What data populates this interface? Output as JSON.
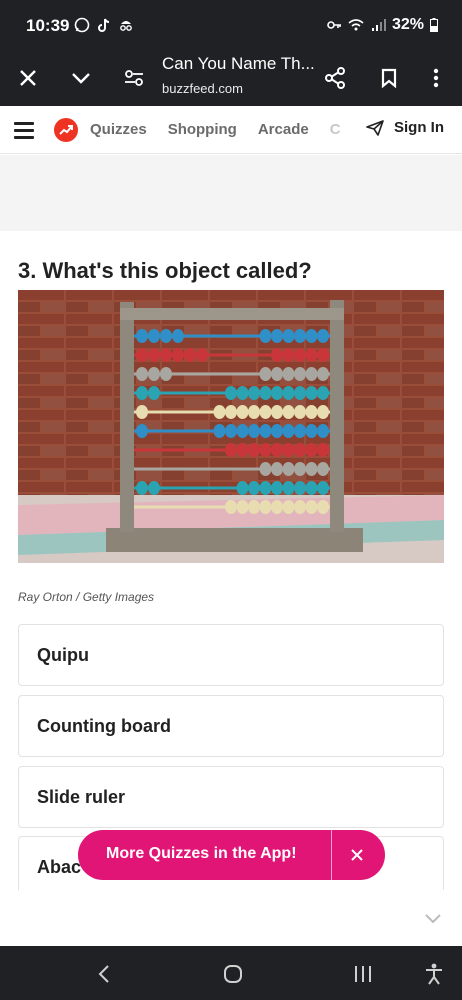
{
  "status": {
    "time": "10:39",
    "battery": "32%"
  },
  "browser": {
    "tab_title": "Can You Name Th...",
    "url": "buzzfeed.com"
  },
  "nav": {
    "links": [
      "Quizzes",
      "Shopping",
      "Arcade",
      "C"
    ],
    "sign_in": "Sign In"
  },
  "quiz": {
    "question": "3. What's this object called?",
    "image_credit": "Ray Orton / Getty Images",
    "answers": [
      "Quipu",
      "Counting board",
      "Slide ruler",
      "Abac"
    ]
  },
  "cta": {
    "label": "More Quizzes in the App!"
  },
  "colors": {
    "accent": "#e01576",
    "brand": "#e32"
  }
}
